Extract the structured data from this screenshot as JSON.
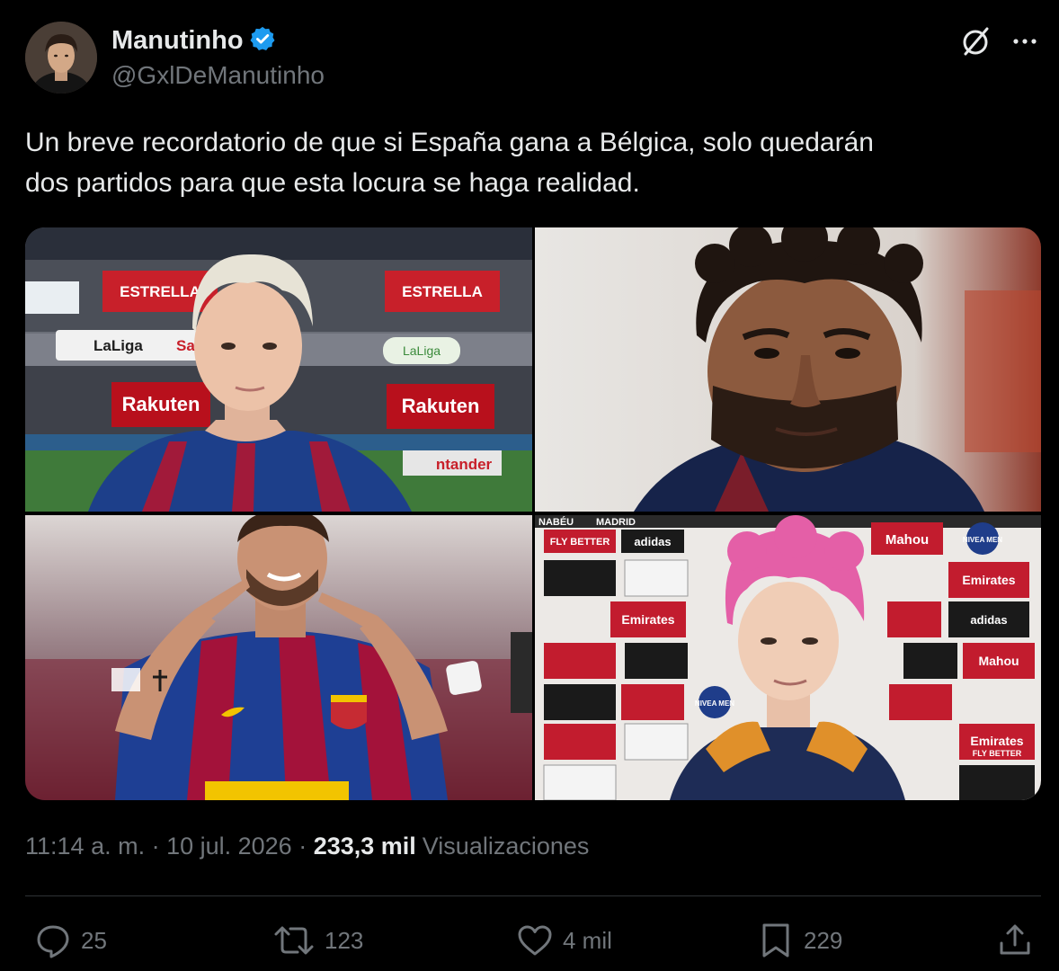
{
  "author": {
    "display_name": "Manutinho",
    "handle": "@GxlDeManutinho",
    "verified": true,
    "verified_color": "#1d9bf0"
  },
  "header_actions": {
    "grok_icon": "grok-slash-circle-icon",
    "more_icon": "more-dots-icon"
  },
  "tweet": {
    "line1": "Un breve recordatorio de que si España gana a Bélgica, solo quedarán",
    "line2": "dos partidos para que esta locura se haga realidad."
  },
  "media": {
    "photo1_signs": [
      "ESTRELLA",
      "ESTRELLA",
      "LaLiga",
      "Sant",
      "LaLiga",
      "Rakuten",
      "Rakuten",
      "ntander"
    ],
    "photo4_signs": [
      "NABÉU",
      "MADRID",
      "FLY BETTER",
      "adidas",
      "Mahou",
      "NIVEA MEN",
      "Emirates",
      "Emirates",
      "adidas",
      "Mahou",
      "NIVEA MEN",
      "Emirates",
      "FLY BETTER"
    ]
  },
  "meta": {
    "time": "11:14 a. m.",
    "sep1": " · ",
    "date": "10 jul. 2026",
    "sep2": " · ",
    "views_count": "233,3 mil",
    "views_label": "Visualizaciones"
  },
  "actions": {
    "replies": "25",
    "retweets": "123",
    "likes": "4 mil",
    "bookmarks": "229"
  },
  "colors": {
    "background": "#000000",
    "text": "#e7e9ea",
    "secondary": "#71767b",
    "divider": "#2f3336"
  }
}
